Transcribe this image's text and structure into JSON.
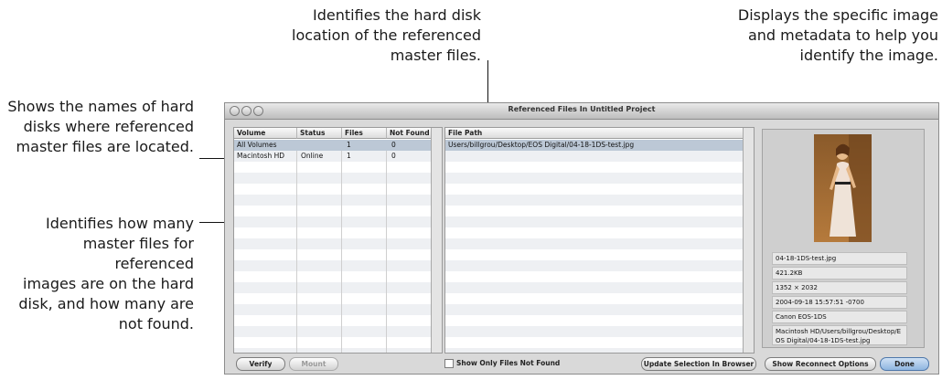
{
  "callouts": {
    "hard_disk_location": "Identifies the hard disk\nlocation of the referenced\nmaster files.",
    "specific_image": "Displays the specific image\nand metadata to help you\nidentify the image.",
    "disk_names": "Shows the names of hard\ndisks where referenced\nmaster files are located.",
    "master_counts": "Identifies how many\nmaster files for referenced\nimages are on the hard\ndisk, and how many are\nnot found."
  },
  "window": {
    "title": "Referenced Files In Untitled Project"
  },
  "volumes_table": {
    "headers": [
      "Volume",
      "Status",
      "Files",
      "Not Found"
    ],
    "rows": [
      {
        "volume": "All Volumes",
        "status": "",
        "files": "1",
        "not_found": "0"
      },
      {
        "volume": "Macintosh HD",
        "status": "Online",
        "files": "1",
        "not_found": "0"
      }
    ]
  },
  "files_table": {
    "header": "File Path",
    "rows": [
      "Users/billgrou/Desktop/EOS Digital/04-18-1DS-test.jpg"
    ]
  },
  "metadata": {
    "filename": "04-18-1DS-test.jpg",
    "size": "421.2KB",
    "dimensions": "1352 × 2032",
    "date": "2004-09-18 15:57:51 -0700",
    "camera": "Canon EOS-1DS",
    "path": "Macintosh HD/Users/billgrou/Desktop/EOS Digital/04-18-1DS-test.jpg"
  },
  "buttons": {
    "verify": "Verify",
    "mount": "Mount",
    "show_only_not_found": "Show Only Files Not Found",
    "update_selection": "Update Selection In Browser",
    "show_reconnect": "Show Reconnect Options",
    "done": "Done"
  },
  "colors": {
    "selection": "#bcc8d6",
    "default_button": "#8fb5e0"
  }
}
